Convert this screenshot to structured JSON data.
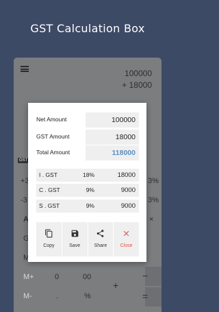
{
  "banner": {
    "title": "GST Calculation Box"
  },
  "calculator": {
    "expression_line1": "100000",
    "expression_line2": "+ 18000",
    "gst_tag": "GST",
    "keys": {
      "plus3": "+3",
      "minus3": "-3",
      "pct_right1": "3%",
      "pct_right2": "3%",
      "a_key": "A",
      "g_key": "G",
      "m_key": "M",
      "mplus": "M+",
      "mminus": "M-",
      "zero": "0",
      "double_zero": "00",
      "dot": ".",
      "percent": "%",
      "plus": "+",
      "minus": "−",
      "equals": "=",
      "times": "×"
    }
  },
  "dialog": {
    "net_amount_label": "Net Amount",
    "net_amount_value": "100000",
    "gst_amount_label": "GST Amount",
    "gst_amount_value": "18000",
    "total_amount_label": "Total Amount",
    "total_amount_value": "118000",
    "taxes": [
      {
        "name": "I . GST",
        "rate": "18%",
        "amount": "18000"
      },
      {
        "name": "C . GST",
        "rate": "9%",
        "amount": "9000"
      },
      {
        "name": "S . GST",
        "rate": "9%",
        "amount": "9000"
      }
    ],
    "actions": {
      "copy": "Copy",
      "save": "Save",
      "share": "Share",
      "close": "Close"
    }
  },
  "colors": {
    "background": "#3d4a66",
    "accent": "#5b8fc3",
    "close": "#e0504a"
  }
}
